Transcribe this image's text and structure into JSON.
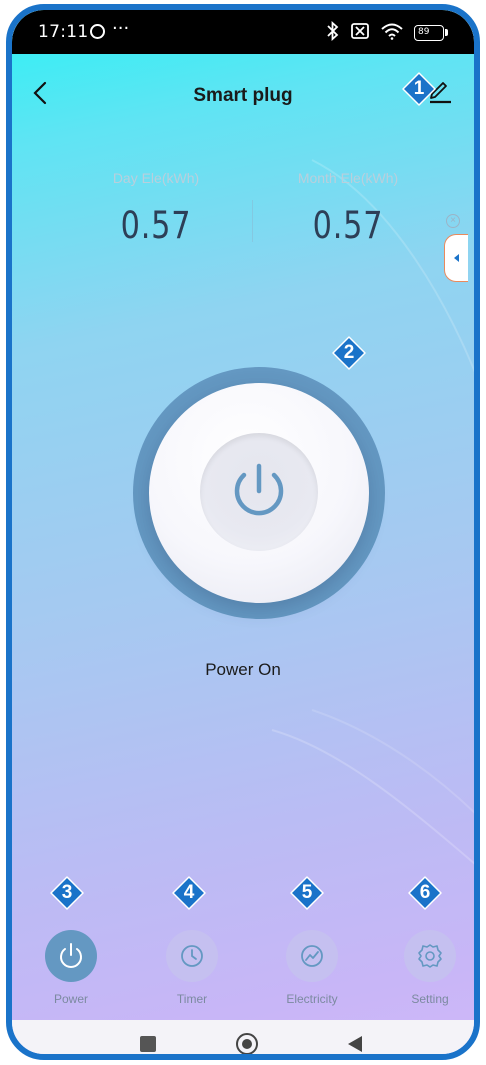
{
  "status_bar": {
    "time": "17:11",
    "dots": "···",
    "battery": "89"
  },
  "header": {
    "title": "Smart plug"
  },
  "stats": {
    "day": {
      "label": "Day Ele(kWh)",
      "value": "0.57"
    },
    "month": {
      "label": "Month Ele(kWh)",
      "value": "0.57"
    }
  },
  "power": {
    "status": "Power On"
  },
  "tabs": [
    {
      "label": "Power",
      "icon": "power-icon"
    },
    {
      "label": "Timer",
      "icon": "clock-icon"
    },
    {
      "label": "Electricity",
      "icon": "chart-icon"
    },
    {
      "label": "Setting",
      "icon": "gear-icon"
    }
  ],
  "badges": [
    "1",
    "2",
    "3",
    "4",
    "5",
    "6"
  ],
  "colors": {
    "accent": "#6498c2",
    "badge": "#1a73c9",
    "frame": "#1a73c9"
  }
}
